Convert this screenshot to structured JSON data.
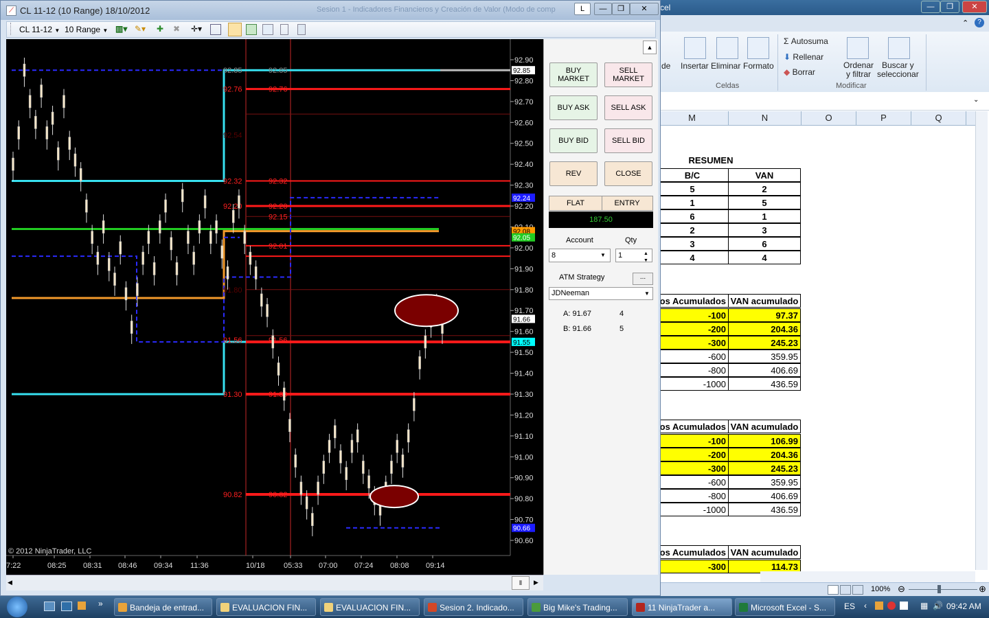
{
  "ninjatrader": {
    "title": "CL 11-12 (10 Range)  18/10/2012",
    "title_faded": "Sesion 1 - Indicadores Financieros y Creación de Valor (Modo de comp",
    "instrument": "CL 11-12",
    "interval": "10 Range",
    "float_button": "L",
    "copyright": "© 2012 NinjaTrader, LLC",
    "chart": {
      "price_ticks": [
        "92.90",
        "92.80",
        "92.70",
        "92.60",
        "92.50",
        "92.40",
        "92.30",
        "92.20",
        "92.10",
        "92.00",
        "91.90",
        "91.80",
        "91.70",
        "91.60",
        "91.50",
        "91.40",
        "91.30",
        "91.20",
        "91.10",
        "91.00",
        "90.90",
        "90.80",
        "90.70",
        "90.60"
      ],
      "time_ticks": [
        "7:22",
        "08:25",
        "08:31",
        "08:46",
        "09:34",
        "11:36",
        "10/18",
        "05:33",
        "07:00",
        "07:24",
        "08:08",
        "09:14"
      ],
      "level_labels": [
        "92.85",
        "92.76",
        "92.54",
        "92.32",
        "92.20",
        "92.15",
        "92.01",
        "91.80",
        "91.56",
        "91.30",
        "90.82"
      ],
      "price_badges": [
        {
          "text": "92.85",
          "color": "#ffffff"
        },
        {
          "text": "92.24",
          "color": "#1c1cff"
        },
        {
          "text": "92.08",
          "color": "#ff9900"
        },
        {
          "text": "92.05",
          "color": "#22cc22"
        },
        {
          "text": "91.66",
          "color": "#ffffff"
        },
        {
          "text": "91.55",
          "color": "#00ffff"
        },
        {
          "text": "90.66",
          "color": "#1c1cff"
        }
      ]
    },
    "order_panel": {
      "buy_market": "BUY MARKET",
      "sell_market": "SELL MARKET",
      "buy_ask": "BUY ASK",
      "sell_ask": "SELL ASK",
      "buy_bid": "BUY BID",
      "sell_bid": "SELL BID",
      "rev": "REV",
      "close": "CLOSE",
      "flat": "FLAT",
      "entry": "ENTRY",
      "pnl": "187.50",
      "account_label": "Account",
      "account_value": "8",
      "qty_label": "Qty",
      "qty_value": "1",
      "atm_label": "ATM Strategy",
      "atm_more": "...",
      "atm_value": "JDNeeman",
      "ask": "A: 91.67",
      "ask_size": "4",
      "bid": "B: 91.66",
      "bid_size": "5"
    }
  },
  "excel": {
    "title": "cel",
    "ribbon": {
      "de": "de",
      "insertar": "Insertar",
      "eliminar": "Eliminar",
      "formato": "Formato",
      "celdas": "Celdas",
      "autosuma": "Σ Autosuma",
      "rellenar": "Rellenar",
      "borrar": "Borrar",
      "ordenar1": "Ordenar",
      "ordenar2": "y filtrar",
      "buscar1": "Buscar y",
      "buscar2": "seleccionar",
      "modificar": "Modificar"
    },
    "columns": [
      "M",
      "N",
      "O",
      "P",
      "Q"
    ],
    "resumen": {
      "title": "RESUMEN",
      "h1": "B/C",
      "h2": "VAN",
      "rows": [
        [
          "5",
          "2"
        ],
        [
          "1",
          "5"
        ],
        [
          "6",
          "1"
        ],
        [
          "2",
          "3"
        ],
        [
          "3",
          "6"
        ],
        [
          "4",
          "4"
        ]
      ]
    },
    "table1": {
      "h1": "os Acumulados",
      "h2": "VAN acumulado",
      "rows": [
        [
          "-100",
          "97.37"
        ],
        [
          "-200",
          "204.36"
        ],
        [
          "-300",
          "245.23"
        ],
        [
          "-600",
          "359.95"
        ],
        [
          "-800",
          "406.69"
        ],
        [
          "-1000",
          "436.59"
        ]
      ]
    },
    "table2": {
      "h1": "os Acumulados",
      "h2": "VAN acumulado",
      "rows": [
        [
          "-100",
          "106.99"
        ],
        [
          "-200",
          "204.36"
        ],
        [
          "-300",
          "245.23"
        ],
        [
          "-600",
          "359.95"
        ],
        [
          "-800",
          "406.69"
        ],
        [
          "-1000",
          "436.59"
        ]
      ]
    },
    "table3": {
      "h1": "os Acumulados",
      "h2": "VAN acumulado",
      "rows": [
        [
          "-300",
          "114.73"
        ]
      ]
    },
    "zoom": "100%"
  },
  "taskbar": {
    "items": [
      {
        "label": "Bandeja de entrad...",
        "color": "#e8a33a"
      },
      {
        "label": "EVALUACION FIN...",
        "color": "#f1d27a"
      },
      {
        "label": "EVALUACION FIN...",
        "color": "#f1d27a"
      },
      {
        "label": "Sesion 2. Indicado...",
        "color": "#d24726"
      },
      {
        "label": "Big Mike's Trading...",
        "color": "#4b9b3c"
      },
      {
        "label": "11 NinjaTrader a...",
        "color": "#b3261e"
      },
      {
        "label": "Microsoft Excel - S...",
        "color": "#1f7a3a"
      }
    ],
    "lang": "ES",
    "time": "09:42 AM"
  }
}
